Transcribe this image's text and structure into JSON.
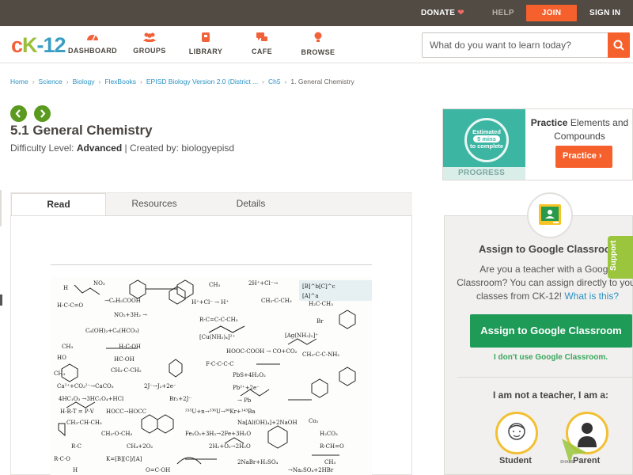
{
  "topbar": {
    "donate": "DONATE",
    "help": "HELP",
    "join": "JOIN",
    "signin": "SIGN IN"
  },
  "nav": {
    "logo_parts": [
      "c",
      "K",
      "-12"
    ],
    "items": [
      {
        "label": "DASHBOARD",
        "icon": "dashboard-icon"
      },
      {
        "label": "GROUPS",
        "icon": "groups-icon"
      },
      {
        "label": "LIBRARY",
        "icon": "library-icon"
      },
      {
        "label": "CAFE",
        "icon": "cafe-icon"
      },
      {
        "label": "BROWSE",
        "icon": "browse-icon"
      }
    ],
    "search_placeholder": "What do you want to learn today?"
  },
  "breadcrumbs": [
    "Home",
    "Science",
    "Biology",
    "FlexBooks",
    "EPISD Biology Version 2.0 (District ...",
    "Ch5",
    "1. General Chemistry"
  ],
  "lesson": {
    "title": "5.1 General Chemistry",
    "difficulty_prefix": "Difficulty Level: ",
    "difficulty": "Advanced",
    "created_by": " | Created by: biologyepisd"
  },
  "tabs": [
    "Read",
    "Resources",
    "Details"
  ],
  "practice": {
    "estimated": "Estimated",
    "mins": "5 mins",
    "complete": "to complete",
    "progress_label": "PROGRESS",
    "heading_bold": "Practice",
    "heading_rest": " Elements and Compounds",
    "button": "Practice"
  },
  "google_classroom": {
    "title": "Assign to Google Classroo",
    "text": "Are you a teacher with a Google Classroom? You can assign directly to your classes from CK-12!",
    "link": "What is this?",
    "button": "Assign to Google Classroom",
    "dont_use": "I don't use Google Classroom.",
    "not_teacher": "I am not a teacher, I am a:",
    "roles": [
      "Student",
      "Parent"
    ]
  },
  "support": "Support",
  "share_label": "SHARE",
  "colors": {
    "topbar": "#514b44",
    "accent_orange": "#f6602d",
    "green": "#1f9b58",
    "link_blue": "#2a91c4",
    "arrow_green": "#5a9a1f",
    "support_green": "#9bc53d",
    "role_ring": "#f2c034"
  }
}
